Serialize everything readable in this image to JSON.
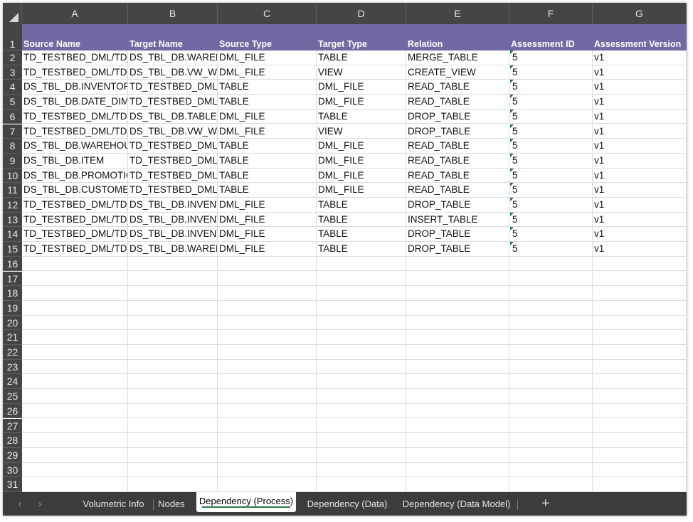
{
  "columns": [
    "A",
    "B",
    "C",
    "D",
    "E",
    "F",
    "G"
  ],
  "headers": [
    "Source Name",
    "Target Name",
    "Source Type",
    "Target Type",
    "Relation",
    "Assessment ID",
    "Assessment Version"
  ],
  "rows": [
    [
      "TD_TESTBED_DML/TD_TE",
      "DS_TBL_DB.WAREHO",
      "DML_FILE",
      "TABLE",
      "MERGE_TABLE",
      "5",
      "v1"
    ],
    [
      "TD_TESTBED_DML/TD_TE",
      "DS_TBL_DB.VW_WA",
      "DML_FILE",
      "VIEW",
      "CREATE_VIEW",
      "5",
      "v1"
    ],
    [
      "DS_TBL_DB.INVENTORY",
      "TD_TESTBED_DML/T",
      "TABLE",
      "DML_FILE",
      "READ_TABLE",
      "5",
      "v1"
    ],
    [
      "DS_TBL_DB.DATE_DIM",
      "TD_TESTBED_DML/T",
      "TABLE",
      "DML_FILE",
      "READ_TABLE",
      "5",
      "v1"
    ],
    [
      "TD_TESTBED_DML/TD_TE",
      "DS_TBL_DB.TABLE_T",
      "DML_FILE",
      "TABLE",
      "DROP_TABLE",
      "5",
      "v1"
    ],
    [
      "TD_TESTBED_DML/TD_TE",
      "DS_TBL_DB.VW_WA",
      "DML_FILE",
      "VIEW",
      "DROP_TABLE",
      "5",
      "v1"
    ],
    [
      "DS_TBL_DB.WAREHOUSE",
      "TD_TESTBED_DML/T",
      "TABLE",
      "DML_FILE",
      "READ_TABLE",
      "5",
      "v1"
    ],
    [
      "DS_TBL_DB.ITEM",
      "TD_TESTBED_DML/T",
      "TABLE",
      "DML_FILE",
      "READ_TABLE",
      "5",
      "v1"
    ],
    [
      "DS_TBL_DB.PROMOTION",
      "TD_TESTBED_DML/T",
      "TABLE",
      "DML_FILE",
      "READ_TABLE",
      "5",
      "v1"
    ],
    [
      "DS_TBL_DB.CUSTOMER",
      "TD_TESTBED_DML/T",
      "TABLE",
      "DML_FILE",
      "READ_TABLE",
      "5",
      "v1"
    ],
    [
      "TD_TESTBED_DML/TD_TE",
      "DS_TBL_DB.INVENTO",
      "DML_FILE",
      "TABLE",
      "DROP_TABLE",
      "5",
      "v1"
    ],
    [
      "TD_TESTBED_DML/TD_TE",
      "DS_TBL_DB.INVENTO",
      "DML_FILE",
      "TABLE",
      "INSERT_TABLE",
      "5",
      "v1"
    ],
    [
      "TD_TESTBED_DML/TD_TE",
      "DS_TBL_DB.INVENTO",
      "DML_FILE",
      "TABLE",
      "DROP_TABLE",
      "5",
      "v1"
    ],
    [
      "TD_TESTBED_DML/TD_TE",
      "DS_TBL_DB.WAREHO",
      "DML_FILE",
      "TABLE",
      "DROP_TABLE",
      "5",
      "v1"
    ]
  ],
  "row_numbers": [
    "1",
    "2",
    "3",
    "4",
    "5",
    "6",
    "7",
    "8",
    "9",
    "10",
    "11",
    "12",
    "13",
    "14",
    "15",
    "16",
    "17",
    "18",
    "19",
    "20",
    "21",
    "22",
    "23",
    "24",
    "25",
    "26",
    "27",
    "28",
    "29",
    "30",
    "31"
  ],
  "sheet_tabs": [
    "Volumetric Info",
    "Nodes",
    "Dependency (Process)",
    "Dependency (Data)",
    "Dependency (Data Model)"
  ],
  "active_tab": "Dependency (Process)",
  "nav": {
    "prev": "‹",
    "next": "›",
    "add": "+"
  },
  "colors": {
    "header_fill": "#7069a3",
    "chrome": "#454545",
    "tab_underline": "#2c7a47"
  }
}
